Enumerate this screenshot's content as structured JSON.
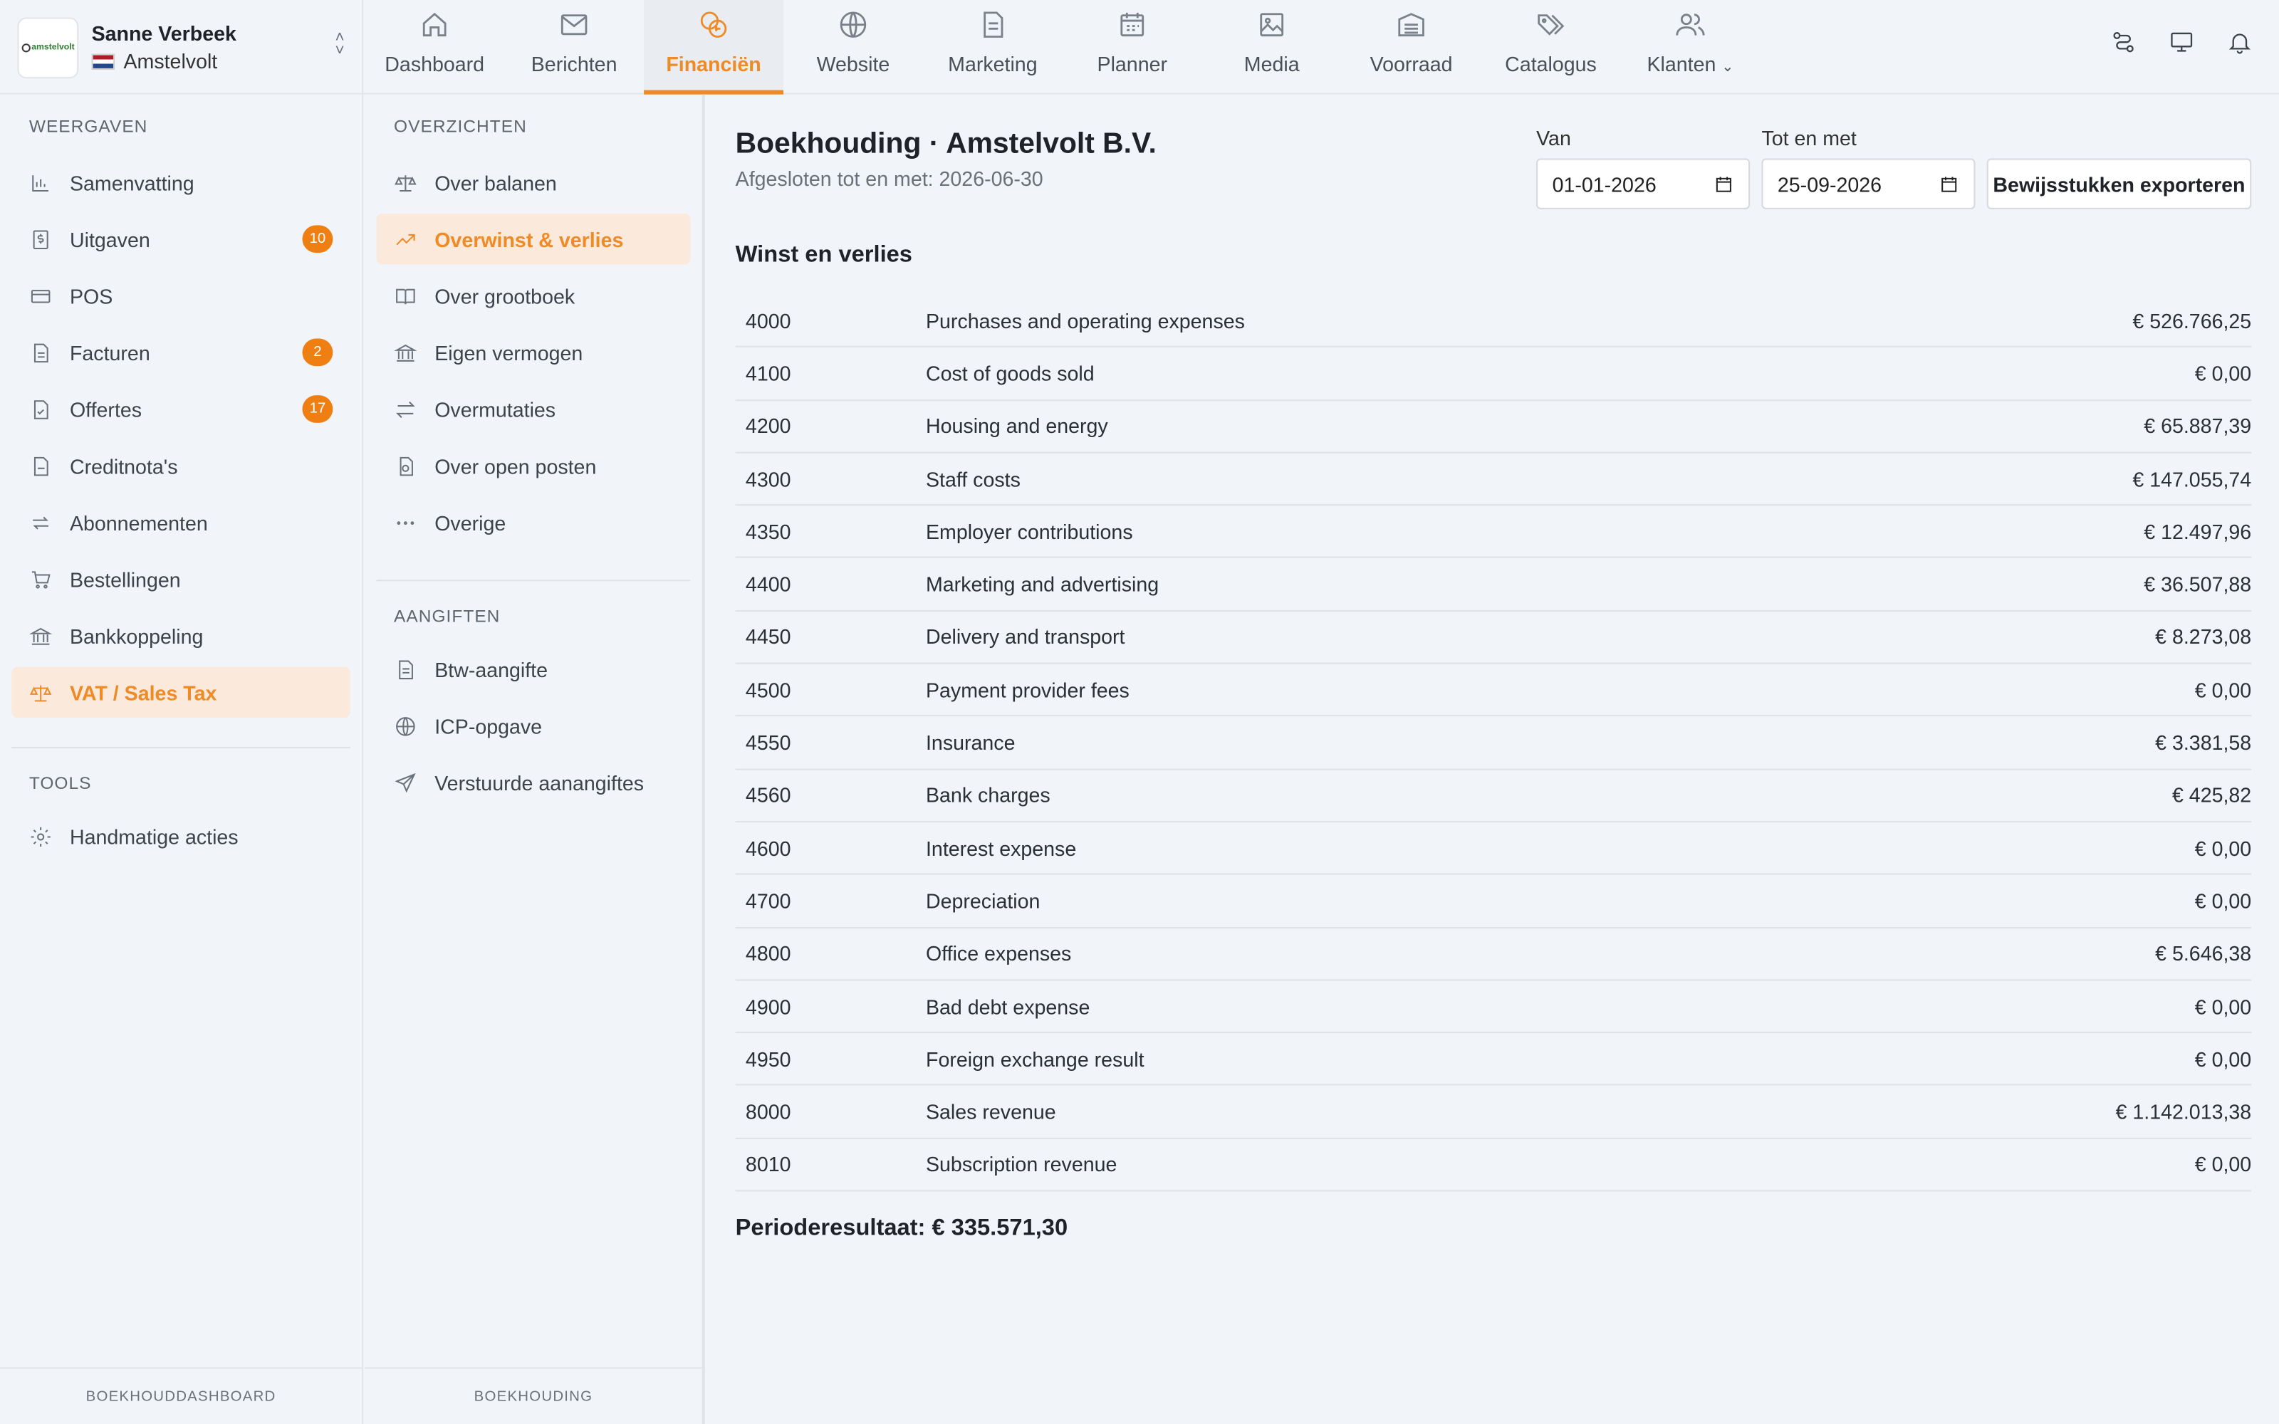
{
  "account": {
    "name": "Sanne Verbeek",
    "company": "Amstelvolt",
    "logo_text": "amstelvolt"
  },
  "nav": [
    {
      "label": "Dashboard",
      "icon": "home-icon"
    },
    {
      "label": "Berichten",
      "icon": "mail-icon"
    },
    {
      "label": "Financiën",
      "icon": "coins-icon",
      "active": true
    },
    {
      "label": "Website",
      "icon": "globe-icon"
    },
    {
      "label": "Marketing",
      "icon": "document-icon"
    },
    {
      "label": "Planner",
      "icon": "calendar-icon"
    },
    {
      "label": "Media",
      "icon": "image-icon"
    },
    {
      "label": "Voorraad",
      "icon": "warehouse-icon"
    },
    {
      "label": "Catalogus",
      "icon": "tags-icon"
    },
    {
      "label": "Klanten",
      "icon": "users-icon"
    }
  ],
  "sidebar": {
    "views_title": "WEERGAVEN",
    "items": [
      {
        "label": "Samenvatting",
        "icon": "bar-chart-icon"
      },
      {
        "label": "Uitgaven",
        "icon": "dollar-receipt-icon",
        "badge": "10"
      },
      {
        "label": "POS",
        "icon": "card-icon"
      },
      {
        "label": "Facturen",
        "icon": "invoice-icon",
        "badge": "2"
      },
      {
        "label": "Offertes",
        "icon": "quote-icon",
        "badge": "17"
      },
      {
        "label": "Creditnota's",
        "icon": "credit-note-icon"
      },
      {
        "label": "Abonnementen",
        "icon": "repeat-icon"
      },
      {
        "label": "Bestellingen",
        "icon": "cart-icon"
      },
      {
        "label": "Bankkoppeling",
        "icon": "bank-icon"
      },
      {
        "label": "VAT / Sales Tax",
        "icon": "scale-icon",
        "active": true
      }
    ],
    "tools_title": "TOOLS",
    "tools": [
      {
        "label": "Handmatige acties",
        "icon": "gear-icon"
      }
    ],
    "footer": "BOEKHOUDDASHBOARD"
  },
  "subnav": {
    "overviews_title": "OVERZICHTEN",
    "items": [
      {
        "label": "Over balanen",
        "icon": "scale-icon"
      },
      {
        "label": "Overwinst & verlies",
        "icon": "trend-icon",
        "active": true
      },
      {
        "label": "Over grootboek",
        "icon": "book-icon"
      },
      {
        "label": "Eigen vermogen",
        "icon": "bank-icon"
      },
      {
        "label": "Overmutaties",
        "icon": "swap-icon"
      },
      {
        "label": "Over open posten",
        "icon": "open-items-icon"
      },
      {
        "label": "Overige",
        "icon": "more-icon"
      }
    ],
    "filings_title": "AANGIFTEN",
    "filings": [
      {
        "label": "Btw-aangifte",
        "icon": "document-icon"
      },
      {
        "label": "ICP-opgave",
        "icon": "globe-icon"
      },
      {
        "label": "Verstuurde aanangiftes",
        "icon": "send-icon"
      }
    ],
    "footer": "BOEKHOUDING"
  },
  "main": {
    "title": "Boekhouding · Amstelvolt B.V.",
    "subtitle": "Afgesloten tot en met: 2026-06-30",
    "from_label": "Van",
    "from_value": "01-01-2026",
    "to_label": "Tot en met",
    "to_value": "25-09-2026",
    "export_label": "Bewijsstukken exporteren",
    "section_title": "Winst en verlies",
    "rows": [
      {
        "code": "4000",
        "desc": "Purchases and operating expenses",
        "amount": "€ 526.766,25"
      },
      {
        "code": "4100",
        "desc": "Cost of goods sold",
        "amount": "€ 0,00"
      },
      {
        "code": "4200",
        "desc": "Housing and energy",
        "amount": "€ 65.887,39"
      },
      {
        "code": "4300",
        "desc": "Staff costs",
        "amount": "€ 147.055,74"
      },
      {
        "code": "4350",
        "desc": "Employer contributions",
        "amount": "€ 12.497,96"
      },
      {
        "code": "4400",
        "desc": "Marketing and advertising",
        "amount": "€ 36.507,88"
      },
      {
        "code": "4450",
        "desc": "Delivery and transport",
        "amount": "€ 8.273,08"
      },
      {
        "code": "4500",
        "desc": "Payment provider fees",
        "amount": "€ 0,00"
      },
      {
        "code": "4550",
        "desc": "Insurance",
        "amount": "€ 3.381,58"
      },
      {
        "code": "4560",
        "desc": "Bank charges",
        "amount": "€ 425,82"
      },
      {
        "code": "4600",
        "desc": "Interest expense",
        "amount": "€ 0,00"
      },
      {
        "code": "4700",
        "desc": "Depreciation",
        "amount": "€ 0,00"
      },
      {
        "code": "4800",
        "desc": "Office expenses",
        "amount": "€ 5.646,38"
      },
      {
        "code": "4900",
        "desc": "Bad debt expense",
        "amount": "€ 0,00"
      },
      {
        "code": "4950",
        "desc": "Foreign exchange result",
        "amount": "€ 0,00"
      },
      {
        "code": "8000",
        "desc": "Sales revenue",
        "amount": "€ 1.142.013,38"
      },
      {
        "code": "8010",
        "desc": "Subscription revenue",
        "amount": "€ 0,00"
      }
    ],
    "result": "Perioderesultaat: € 335.571,30"
  },
  "colors": {
    "accent": "#f08a24",
    "badge": "#f07f13",
    "active_bg": "#fbe9dc"
  }
}
